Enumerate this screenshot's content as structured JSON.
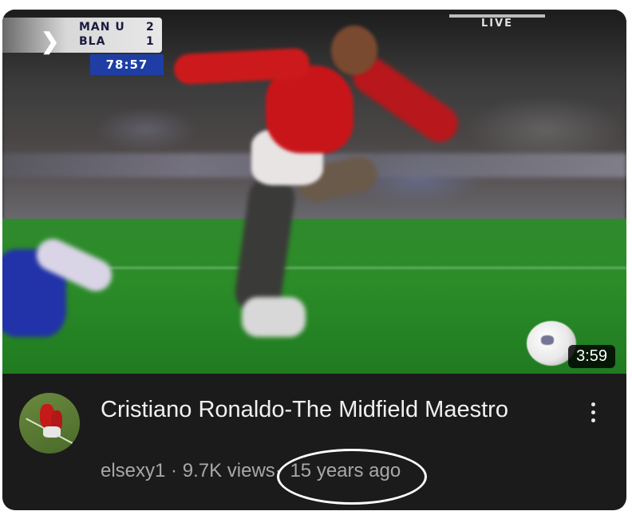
{
  "video": {
    "duration": "3:59",
    "title": "Cristiano Ronaldo-The Midfield Maestro",
    "channel": "elsexy1",
    "separator": "·",
    "views": "9.7K views",
    "age": "15 years ago"
  },
  "thumbnail_overlay": {
    "team1": "MAN U",
    "score1": "2",
    "team2": "BLA",
    "score2": "1",
    "clock": "78:57",
    "live": "LIVE"
  },
  "icons": {
    "more": "more-vert-icon",
    "avatar": "channel-avatar"
  },
  "colors": {
    "card_background": "#1b1b1b",
    "title_text": "#f1f1f1",
    "meta_text": "#a8a8a8",
    "annotation_circle": "#ffffff"
  }
}
